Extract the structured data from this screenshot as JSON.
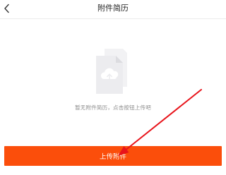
{
  "header": {
    "title": "附件简历",
    "back_icon": "chevron-left-icon"
  },
  "empty_state": {
    "illustration_icon": "cloud-upload-document-icon",
    "message": "暂无附件简历，点击按钮上传吧"
  },
  "footer": {
    "upload_label": "上传附件",
    "button_color": "#fb4e0b"
  },
  "annotation": {
    "arrow_color": "#e8141b"
  }
}
